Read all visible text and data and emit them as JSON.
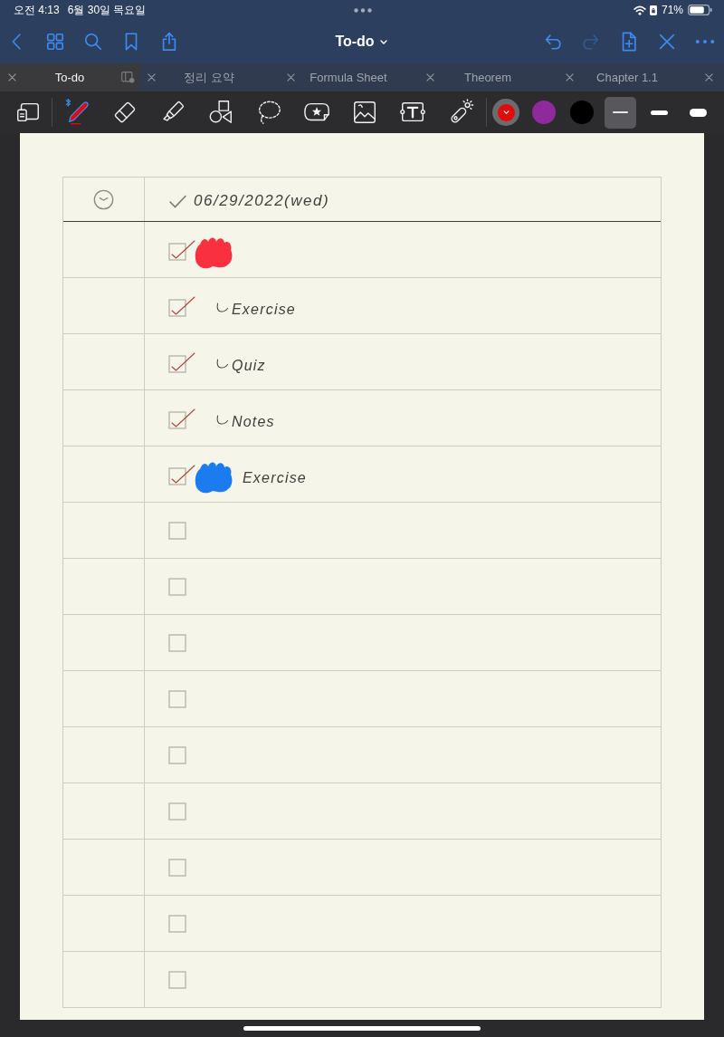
{
  "status_bar": {
    "time": "오전 4:13",
    "date": "6월 30일 목요일",
    "battery": "71%"
  },
  "nav": {
    "title": "To-do",
    "undo": {
      "disabled": false
    },
    "redo": {
      "disabled": true
    }
  },
  "tabs": [
    {
      "label": "To-do",
      "selected": true
    },
    {
      "label": "정리 요약",
      "selected": false
    },
    {
      "label": "Formula Sheet",
      "selected": false
    },
    {
      "label": "Theorem",
      "selected": false
    },
    {
      "label": "Chapter 1.1",
      "selected": false
    },
    {
      "selected": false
    }
  ],
  "tools": [
    {
      "selected": false
    },
    {
      "selected": true
    },
    {
      "selected": false
    },
    {
      "selected": false
    },
    {
      "selected": false
    },
    {
      "selected": false
    },
    {
      "selected": false
    },
    {
      "selected": false
    },
    {
      "selected": false
    },
    {
      "selected": false
    }
  ],
  "colors": [
    {
      "color": "#e20b0b",
      "selected": true
    },
    {
      "color": "#8e2a9c",
      "selected": false
    },
    {
      "color": "#000000",
      "selected": false
    }
  ],
  "stroke_widths": [
    {
      "selected": true
    },
    {
      "selected": false
    },
    {
      "selected": false
    }
  ],
  "page": {
    "header": {
      "date": "06/29/2022(wed)"
    },
    "rows": [
      {
        "checked": true,
        "scribble": {
          "color": "#f8303f"
        },
        "children": [
          {
            "checked": true,
            "text": "Exercise"
          },
          {
            "checked": true,
            "text": "Quiz"
          },
          {
            "checked": true,
            "text": "Notes"
          }
        ]
      },
      {
        "checked": true,
        "scribble": {
          "color": "#1b7cef"
        },
        "text": "Exercise"
      },
      {
        "checked": false
      },
      {
        "checked": false
      },
      {
        "checked": false
      },
      {
        "checked": false
      },
      {
        "checked": false
      },
      {
        "checked": false
      },
      {
        "checked": false
      },
      {
        "checked": false
      },
      {
        "checked": false
      }
    ]
  }
}
